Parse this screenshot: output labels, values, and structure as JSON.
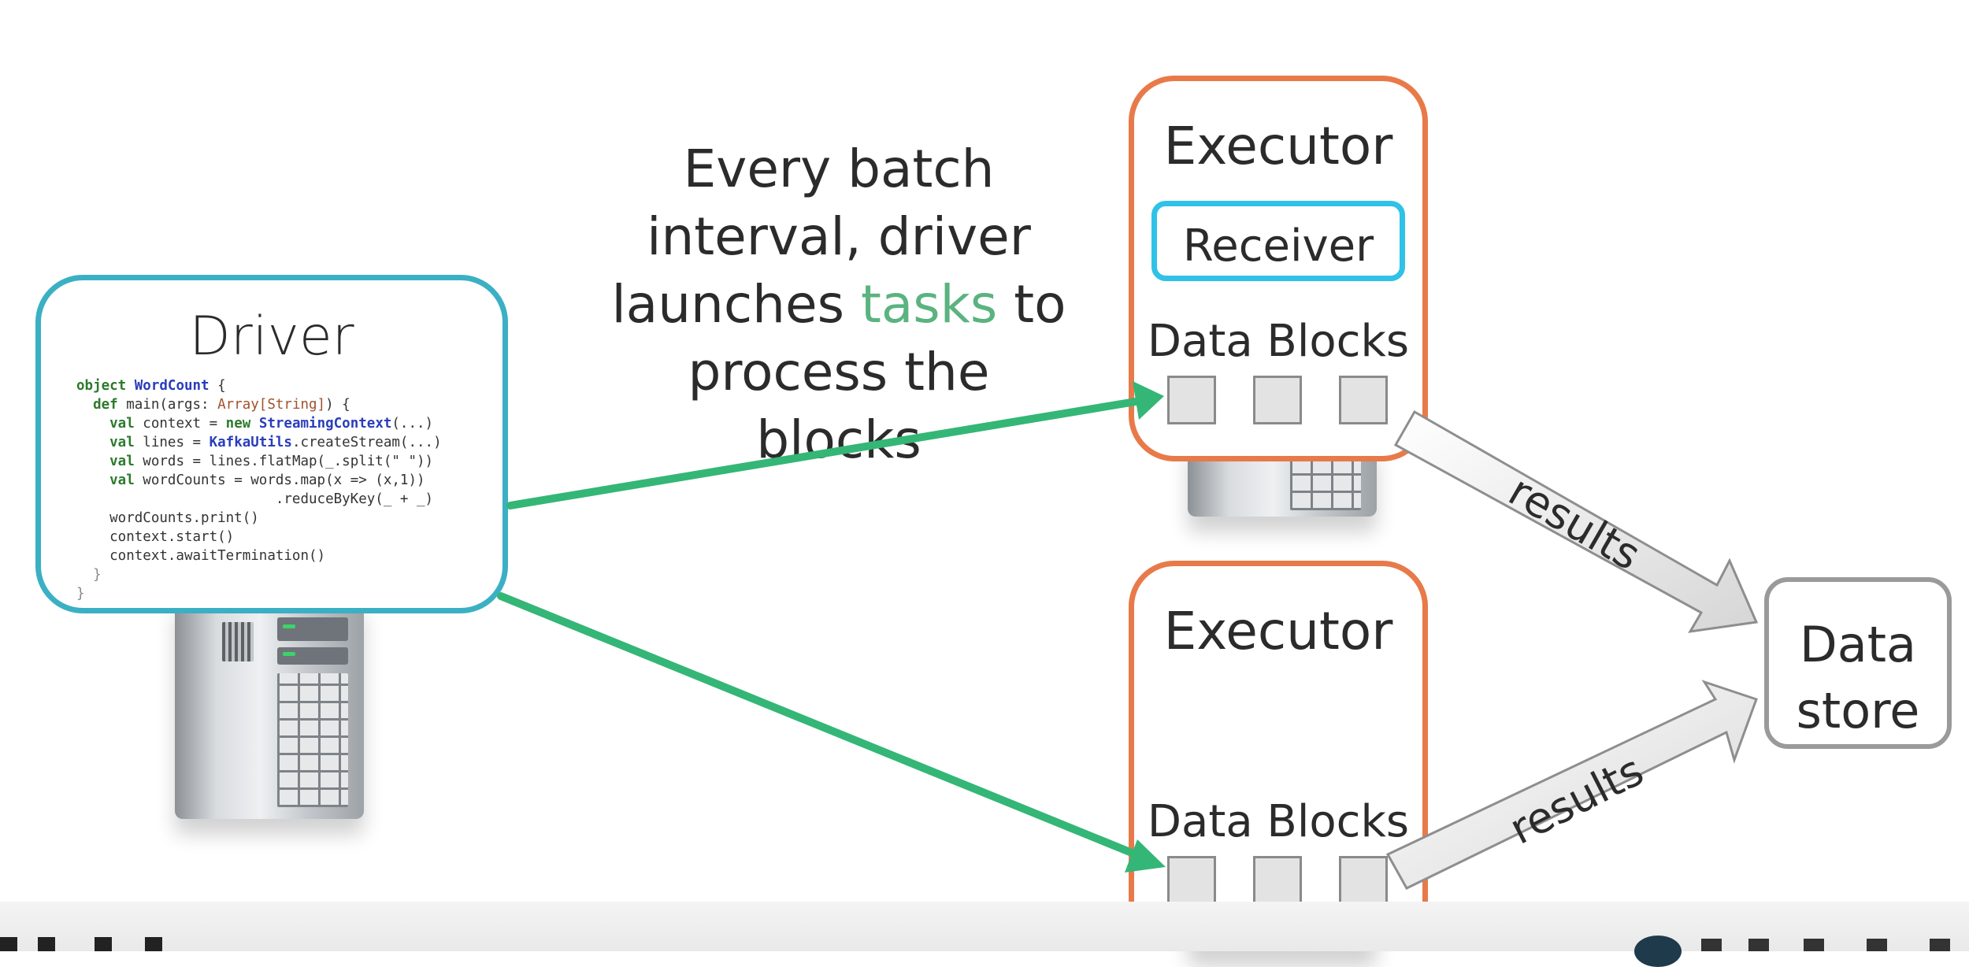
{
  "driver": {
    "title": "Driver",
    "code_lines": [
      {
        "segs": [
          {
            "t": "object ",
            "c": "kw"
          },
          {
            "t": "WordCount",
            "c": "ty"
          },
          {
            "t": " {",
            "c": ""
          }
        ]
      },
      {
        "segs": [
          {
            "t": "  def ",
            "c": "kw"
          },
          {
            "t": "main(args: ",
            "c": ""
          },
          {
            "t": "Array[String]",
            "c": "ty2"
          },
          {
            "t": ") {",
            "c": ""
          }
        ]
      },
      {
        "segs": [
          {
            "t": "    val ",
            "c": "kw"
          },
          {
            "t": "context = ",
            "c": ""
          },
          {
            "t": "new ",
            "c": "kw"
          },
          {
            "t": "StreamingContext",
            "c": "ty"
          },
          {
            "t": "(...)",
            "c": ""
          }
        ]
      },
      {
        "segs": [
          {
            "t": "    val ",
            "c": "kw"
          },
          {
            "t": "lines = ",
            "c": ""
          },
          {
            "t": "KafkaUtils",
            "c": "ty"
          },
          {
            "t": ".createStream(...)",
            "c": ""
          }
        ]
      },
      {
        "segs": [
          {
            "t": "    val ",
            "c": "kw"
          },
          {
            "t": "words = lines.flatMap(_.split(\" \"))",
            "c": ""
          }
        ]
      },
      {
        "segs": [
          {
            "t": "    val ",
            "c": "kw"
          },
          {
            "t": "wordCounts = words.map(x => (x,1))",
            "c": ""
          }
        ]
      },
      {
        "segs": [
          {
            "t": "                        .reduceByKey(_ + _)",
            "c": ""
          }
        ]
      },
      {
        "segs": [
          {
            "t": "    wordCounts.print()",
            "c": ""
          }
        ]
      },
      {
        "segs": [
          {
            "t": "    context.start()",
            "c": ""
          }
        ]
      },
      {
        "segs": [
          {
            "t": "    context.awaitTermination()",
            "c": ""
          }
        ]
      },
      {
        "segs": [
          {
            "t": "  }",
            "c": "mu"
          }
        ]
      },
      {
        "segs": [
          {
            "t": "}",
            "c": "mu"
          }
        ]
      }
    ]
  },
  "caption": {
    "line1": "Every batch",
    "line2": "interval, driver",
    "line3_pre": "launches ",
    "line3_highlight": "tasks",
    "line3_post": " to",
    "line4": "process the blocks"
  },
  "executors": [
    {
      "title": "Executor",
      "receiver_label": "Receiver",
      "blocks_label": "Data Blocks"
    },
    {
      "title": "Executor",
      "blocks_label": "Data Blocks"
    }
  ],
  "results_labels": [
    "results",
    "results"
  ],
  "datastore": {
    "label": "Data\nstore"
  },
  "colors": {
    "arrow_green": "#34b677",
    "driver_border": "#3bb0c4",
    "executor_border": "#e87a4a",
    "receiver_border": "#2fc2e6",
    "highlight_tasks": "#5bb37f",
    "datastore_border": "#9a9a9a"
  },
  "icons": [
    "server-icon"
  ]
}
